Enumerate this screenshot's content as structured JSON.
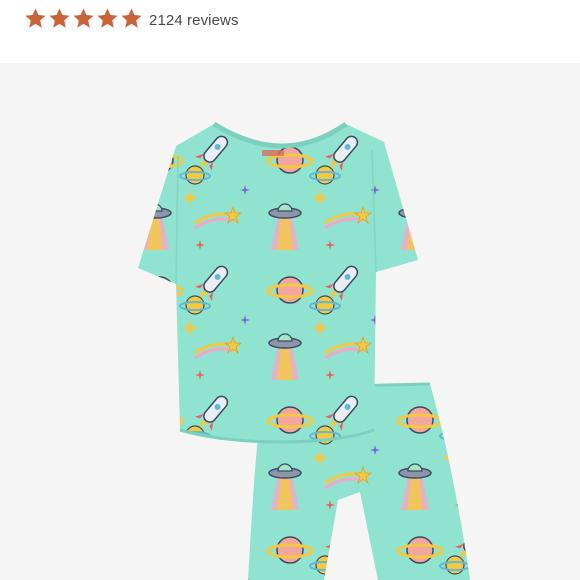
{
  "rating": {
    "stars_filled": 5,
    "stars_total": 5,
    "review_count_text": "2124 reviews",
    "star_color": "#c8643a"
  },
  "product_image": {
    "background_color": "#f5f5f5",
    "garment_color": "#8fe3cf",
    "pattern": "space-print"
  }
}
